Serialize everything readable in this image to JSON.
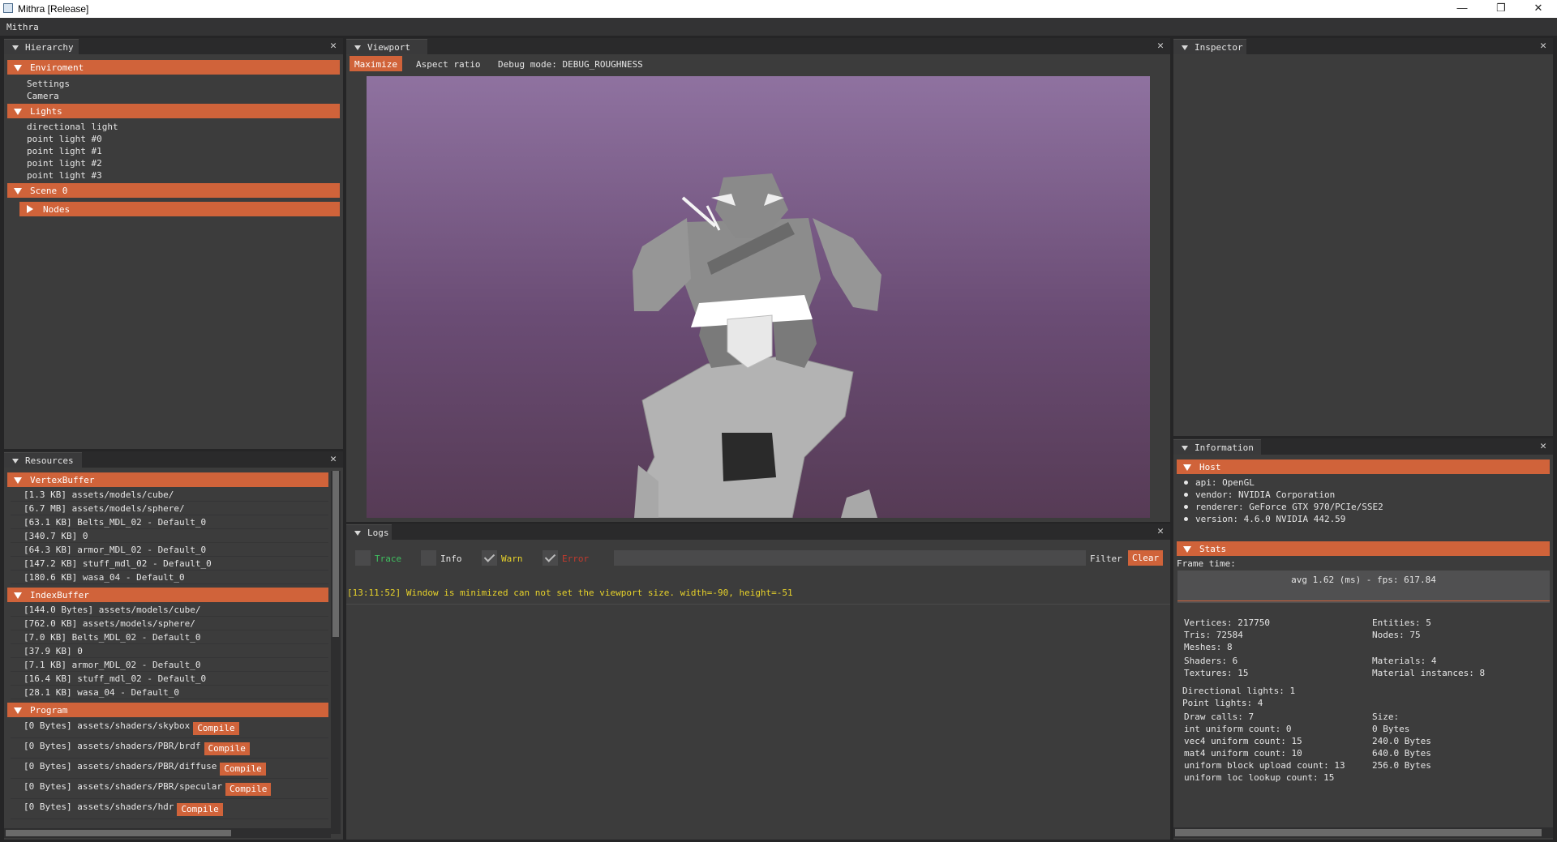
{
  "window": {
    "title": "Mithra [Release]",
    "minimize": "—",
    "maximize": "❐",
    "close": "✕"
  },
  "menu": {
    "app": "Mithra"
  },
  "hierarchy": {
    "tab": "Hierarchy",
    "close": "✕",
    "sections": [
      {
        "label": "Enviroment",
        "items": [
          "Settings",
          "Camera"
        ]
      },
      {
        "label": "Lights",
        "items": [
          "directional light",
          "point light #0",
          "point light #1",
          "point light #2",
          "point light #3"
        ]
      },
      {
        "label": "Scene 0",
        "items": []
      }
    ],
    "nodes_label": "Nodes"
  },
  "resources": {
    "tab": "Resources",
    "close": "✕",
    "compile_label": "Compile",
    "vertex": {
      "label": "VertexBuffer",
      "rows": [
        "[1.3 KB] assets/models/cube/",
        "[6.7 MB] assets/models/sphere/",
        "[63.1 KB] Belts_MDL_02 - Default_0",
        "[340.7 KB] 0",
        "[64.3 KB] armor_MDL_02 - Default_0",
        "[147.2 KB] stuff_mdl_02 - Default_0",
        "[180.6 KB] wasa_04 - Default_0"
      ]
    },
    "index": {
      "label": "IndexBuffer",
      "rows": [
        "[144.0 Bytes] assets/models/cube/",
        "[762.0 KB] assets/models/sphere/",
        "[7.0 KB] Belts_MDL_02 - Default_0",
        "[37.9 KB] 0",
        "[7.1 KB] armor_MDL_02 - Default_0",
        "[16.4 KB] stuff_mdl_02 - Default_0",
        "[28.1 KB] wasa_04 - Default_0"
      ]
    },
    "program": {
      "label": "Program",
      "rows": [
        "[0 Bytes] assets/shaders/skybox",
        "[0 Bytes] assets/shaders/PBR/brdf",
        "[0 Bytes] assets/shaders/PBR/diffuse",
        "[0 Bytes] assets/shaders/PBR/specular",
        "[0 Bytes] assets/shaders/hdr"
      ]
    }
  },
  "viewport": {
    "tab": "Viewport",
    "close": "✕",
    "maximize": "Maximize",
    "aspect": "Aspect ratio",
    "debug": "Debug mode: DEBUG_ROUGHNESS"
  },
  "logs": {
    "tab": "Logs",
    "close": "✕",
    "trace": "Trace",
    "info": "Info",
    "warn": "Warn",
    "error": "Error",
    "filter_label": "Filter",
    "clear": "Clear",
    "entry": "[13:11:52] Window is minimized can not set the viewport size. width=-90, height=-51",
    "trace_checked": false,
    "info_checked": false,
    "warn_checked": true,
    "error_checked": true
  },
  "inspector": {
    "tab": "Inspector",
    "close": "✕"
  },
  "information": {
    "tab": "Information",
    "close": "✕",
    "host_label": "Host",
    "host": [
      "api: OpenGL",
      "vendor: NVIDIA Corporation",
      "renderer: GeForce GTX 970/PCIe/SSE2",
      "version: 4.6.0 NVIDIA 442.59"
    ],
    "stats_label": "Stats",
    "frame_time_label": "Frame time:",
    "frame_summary": "avg 1.62 (ms) - fps: 617.84",
    "left_col": [
      "Vertices: 217750",
      "Tris: 72584",
      "Meshes: 8",
      "Shaders: 6",
      "Textures: 15"
    ],
    "right_col": [
      "Entities: 5",
      "Nodes: 75",
      "Materials: 4",
      "Material instances: 8"
    ],
    "lights": [
      "Directional lights: 1",
      "Point lights: 4"
    ],
    "draw_left": [
      "Draw calls: 7",
      "int uniform count: 0",
      "vec4 uniform count: 15",
      "mat4 uniform count: 10",
      "uniform block upload count: 13",
      "uniform loc lookup count: 15"
    ],
    "draw_right": [
      "Size:",
      "0 Bytes",
      "240.0 Bytes",
      "640.0 Bytes",
      "256.0 Bytes"
    ]
  },
  "colors": {
    "accent": "#d0633a",
    "panel": "#3c3c3c",
    "warn": "#e7d22a",
    "trace": "#3fbf5f",
    "error": "#c43a2e"
  }
}
